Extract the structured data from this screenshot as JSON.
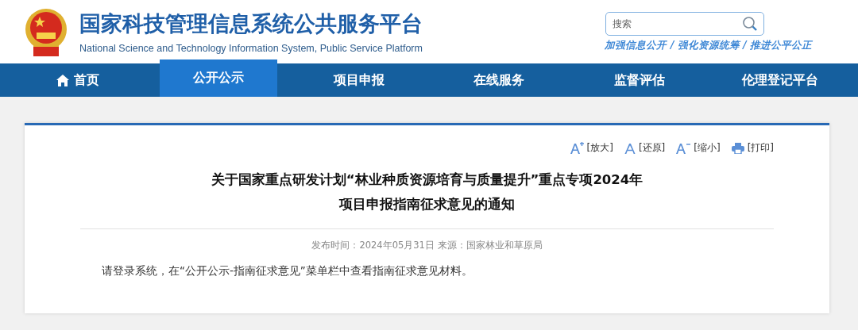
{
  "header": {
    "title": "国家科技管理信息系统公共服务平台",
    "subtitle": "National Science and Technology Information System, Public Service Platform",
    "search": {
      "placeholder": "搜索"
    },
    "slogan": "加强信息公开 / 强化资源统筹 / 推进公平公正"
  },
  "nav": [
    {
      "label": "首页",
      "selected": false,
      "kind": "home"
    },
    {
      "label": "公开公示",
      "selected": true,
      "kind": "plain"
    },
    {
      "label": "项目申报",
      "selected": false,
      "kind": "plain"
    },
    {
      "label": "在线服务",
      "selected": false,
      "kind": "plain"
    },
    {
      "label": "监督评估",
      "selected": false,
      "kind": "plain"
    },
    {
      "label": "伦理登记平台",
      "selected": false,
      "kind": "plain"
    }
  ],
  "tools": [
    {
      "kind": "enlarge",
      "label": "[放大]"
    },
    {
      "kind": "reset",
      "label": "[还原]"
    },
    {
      "kind": "shrink",
      "label": "[缩小]"
    },
    {
      "kind": "print",
      "label": "[打印]"
    }
  ],
  "article": {
    "title_lines": [
      "关于国家重点研发计划“林业种质资源培育与质量提升”重点专项2024年",
      "项目申报指南征求意见的通知"
    ],
    "meta": "发布时间：2024年05月31日 来源：国家林业和草原局",
    "body": "请登录系统，在“公开公示-指南征求意见”菜单栏中查看指南征求意见材料。"
  }
}
